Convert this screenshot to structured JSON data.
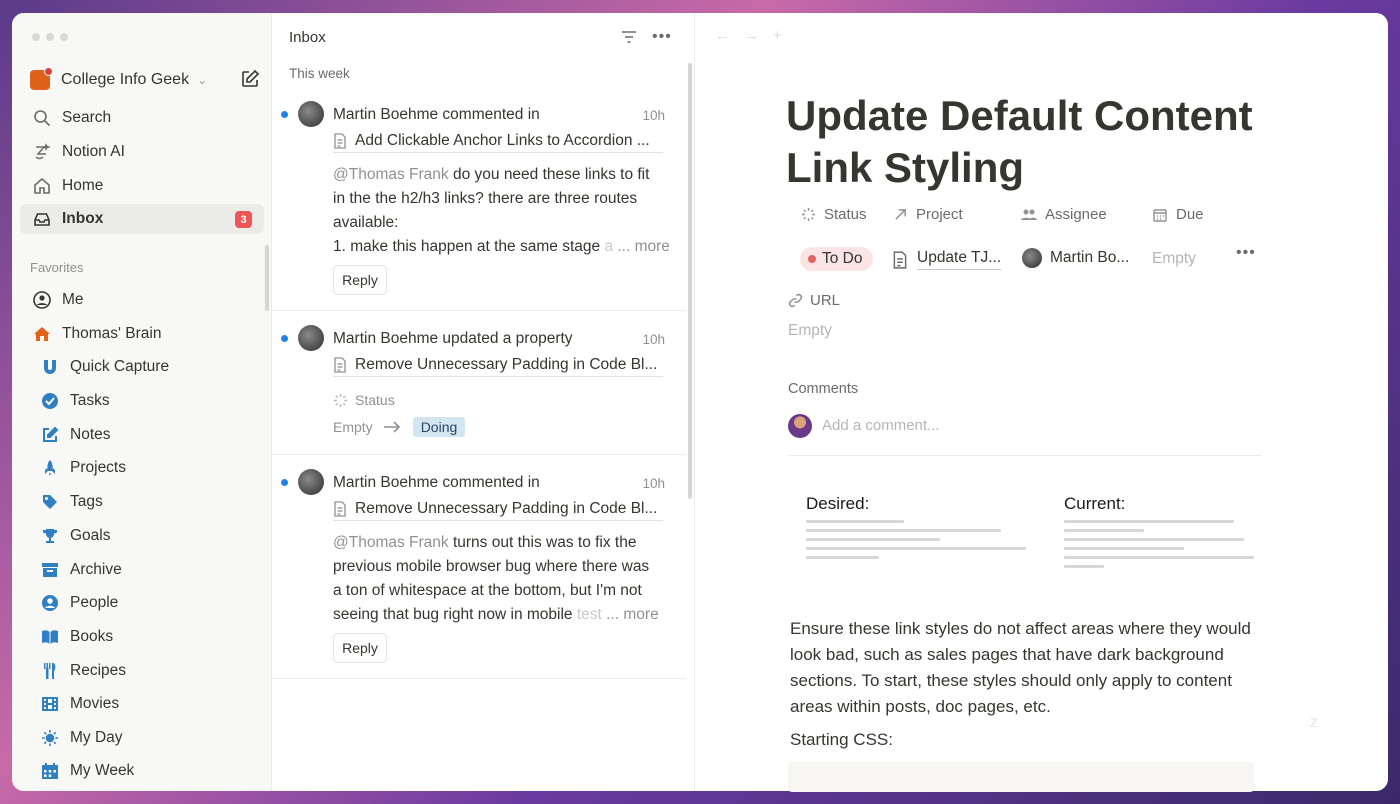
{
  "sidebar": {
    "workspace": "College Info Geek",
    "nav": [
      {
        "label": "Search",
        "icon": "search-icon"
      },
      {
        "label": "Notion AI",
        "icon": "notion-ai-icon"
      },
      {
        "label": "Home",
        "icon": "home-icon"
      },
      {
        "label": "Inbox",
        "icon": "inbox-icon",
        "badge": "3"
      }
    ],
    "favorites_label": "Favorites",
    "favorites": [
      {
        "label": "Me",
        "icon": "person-circle-icon"
      },
      {
        "label": "Thomas' Brain",
        "icon": "house-icon"
      },
      {
        "label": "Quick Capture",
        "icon": "magnet-icon"
      },
      {
        "label": "Tasks",
        "icon": "check-circle-icon"
      },
      {
        "label": "Notes",
        "icon": "note-edit-icon"
      },
      {
        "label": "Projects",
        "icon": "rocket-icon"
      },
      {
        "label": "Tags",
        "icon": "tag-icon"
      },
      {
        "label": "Goals",
        "icon": "trophy-icon"
      },
      {
        "label": "Archive",
        "icon": "archive-icon"
      },
      {
        "label": "People",
        "icon": "person-icon"
      },
      {
        "label": "Books",
        "icon": "book-icon"
      },
      {
        "label": "Recipes",
        "icon": "utensils-icon"
      },
      {
        "label": "Movies",
        "icon": "film-icon"
      },
      {
        "label": "My Day",
        "icon": "sun-icon"
      },
      {
        "label": "My Week",
        "icon": "calendar-icon"
      }
    ]
  },
  "inbox": {
    "title": "Inbox",
    "section": "This week",
    "notifications": [
      {
        "author": "Martin Boehme",
        "action": "commented in",
        "time": "10h",
        "page": "Add Clickable Anchor Links to Accordion ...",
        "mention": "@Thomas Frank",
        "line1": "do you need these links to fit",
        "line2": "in the the h2/h3 links? there are three routes",
        "line3": "available:",
        "line4": "1. make this happen at the same stage",
        "line4_fade": "a",
        "more": "... more",
        "reply": "Reply"
      },
      {
        "author": "Martin Boehme",
        "action": "updated a property",
        "time": "10h",
        "page": "Remove Unnecessary Padding in Code Bl...",
        "prop": "Status",
        "from": "Empty",
        "to": "Doing"
      },
      {
        "author": "Martin Boehme",
        "action": "commented in",
        "time": "10h",
        "page": "Remove Unnecessary Padding in Code Bl...",
        "mention": "@Thomas Frank",
        "line1": "turns out this was to fix the",
        "line2": "previous mobile browser bug where there was",
        "line3": "a ton of whitespace at the bottom, but I'm not",
        "line4": "seeing that bug right now in mobile",
        "line4_fade": "test",
        "more": "... more",
        "reply": "Reply"
      }
    ]
  },
  "page": {
    "title": "Update Default Content Link Styling",
    "props": {
      "status_label": "Status",
      "status_value": "To Do",
      "project_label": "Project",
      "project_value": "Update TJ...",
      "assignee_label": "Assignee",
      "assignee_value": "Martin Bo...",
      "due_label": "Due",
      "due_value": "Empty",
      "url_label": "URL",
      "url_value": "Empty"
    },
    "comments_label": "Comments",
    "comment_placeholder": "Add a comment...",
    "desired": "Desired:",
    "current": "Current:",
    "body": "Ensure these link styles do not affect areas where they would look bad, such as sales pages that have dark background sections. To start, these styles should only apply to content areas within posts, doc pages, etc.",
    "css_label": "Starting CSS:"
  }
}
